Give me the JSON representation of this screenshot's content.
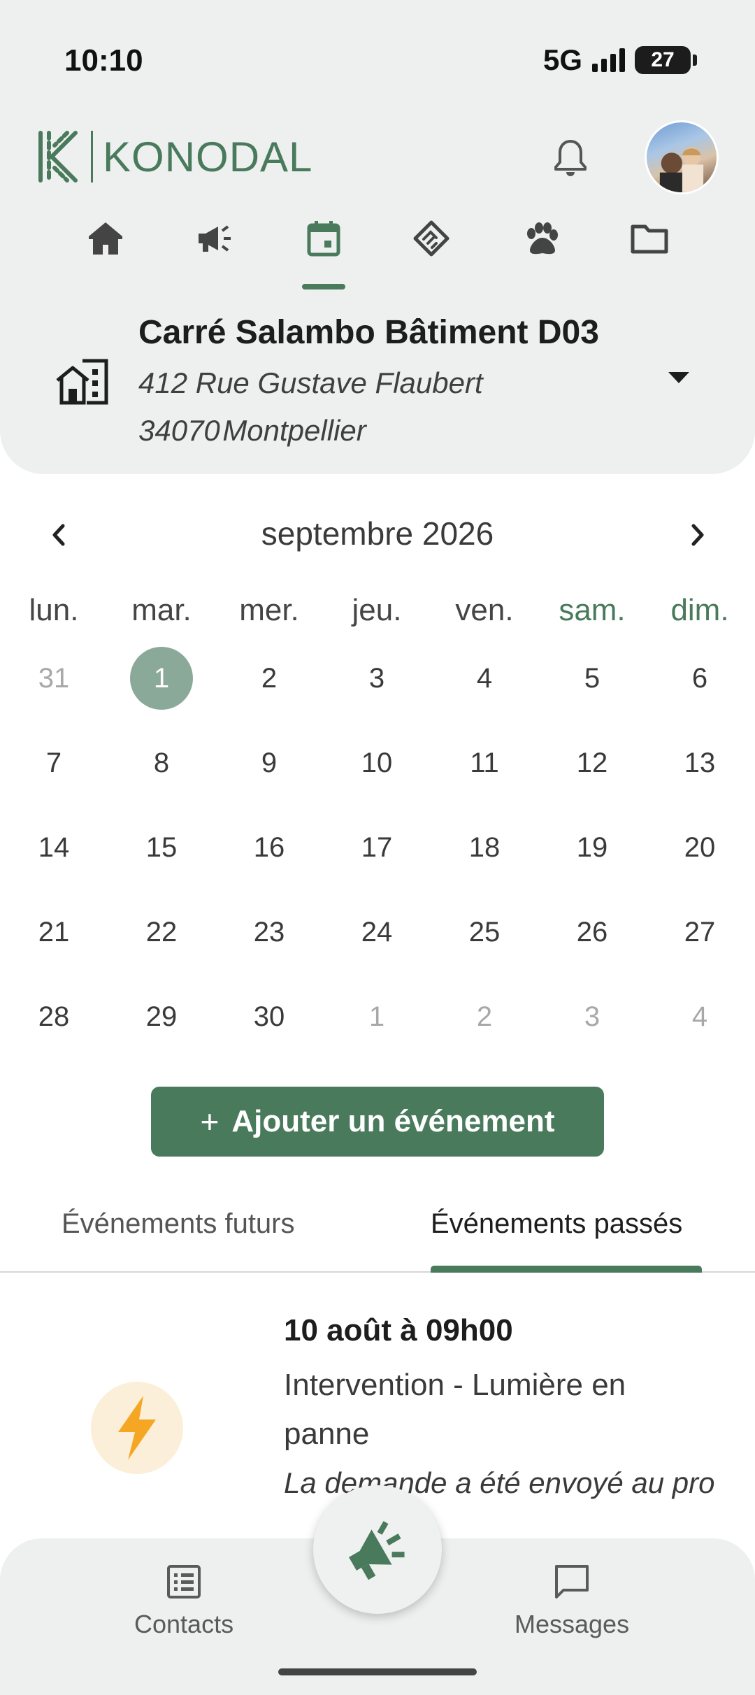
{
  "status_bar": {
    "time": "10:10",
    "network": "5G",
    "battery": "27"
  },
  "header": {
    "brand": "KONODAL",
    "icons": {
      "notifications": "bell-icon",
      "profile": "avatar"
    },
    "nav_tabs": [
      {
        "icon": "home-icon"
      },
      {
        "icon": "megaphone-icon"
      },
      {
        "icon": "calendar-icon",
        "active": true
      },
      {
        "icon": "handshake-icon"
      },
      {
        "icon": "paw-icon"
      },
      {
        "icon": "folder-icon"
      }
    ]
  },
  "address": {
    "title": "Carré Salambo Bâtiment D03",
    "street": "412 Rue Gustave Flaubert",
    "postal_code": "34070",
    "city": "Montpellier"
  },
  "calendar": {
    "month_label": "septembre 2026",
    "weekdays": [
      "lun.",
      "mar.",
      "mer.",
      "jeu.",
      "ven.",
      "sam.",
      "dim."
    ],
    "weeks": [
      [
        "31",
        "1",
        "2",
        "3",
        "4",
        "5",
        "6"
      ],
      [
        "7",
        "8",
        "9",
        "10",
        "11",
        "12",
        "13"
      ],
      [
        "14",
        "15",
        "16",
        "17",
        "18",
        "19",
        "20"
      ],
      [
        "21",
        "22",
        "23",
        "24",
        "25",
        "26",
        "27"
      ],
      [
        "28",
        "29",
        "30",
        "1",
        "2",
        "3",
        "4"
      ]
    ],
    "selected_day": "1"
  },
  "actions": {
    "add_event": "Ajouter un événement",
    "add_symbol": "+"
  },
  "event_tabs": {
    "future": "Événements futurs",
    "past": "Événements passés",
    "active": "past"
  },
  "events": [
    {
      "icon": "lightning-icon",
      "date": "10 août à 09h00",
      "title": "Intervention - Lumière en panne",
      "status": "La demande a été envoyé au pro"
    }
  ],
  "bottom_nav": {
    "contacts": "Contacts",
    "messages": "Messages",
    "center": "megaphone-icon"
  },
  "colors": {
    "accent": "#4a7a5c",
    "selected_day": "#8aa999",
    "panel_bg": "#edf0ef",
    "bolt": "#f5a623"
  }
}
